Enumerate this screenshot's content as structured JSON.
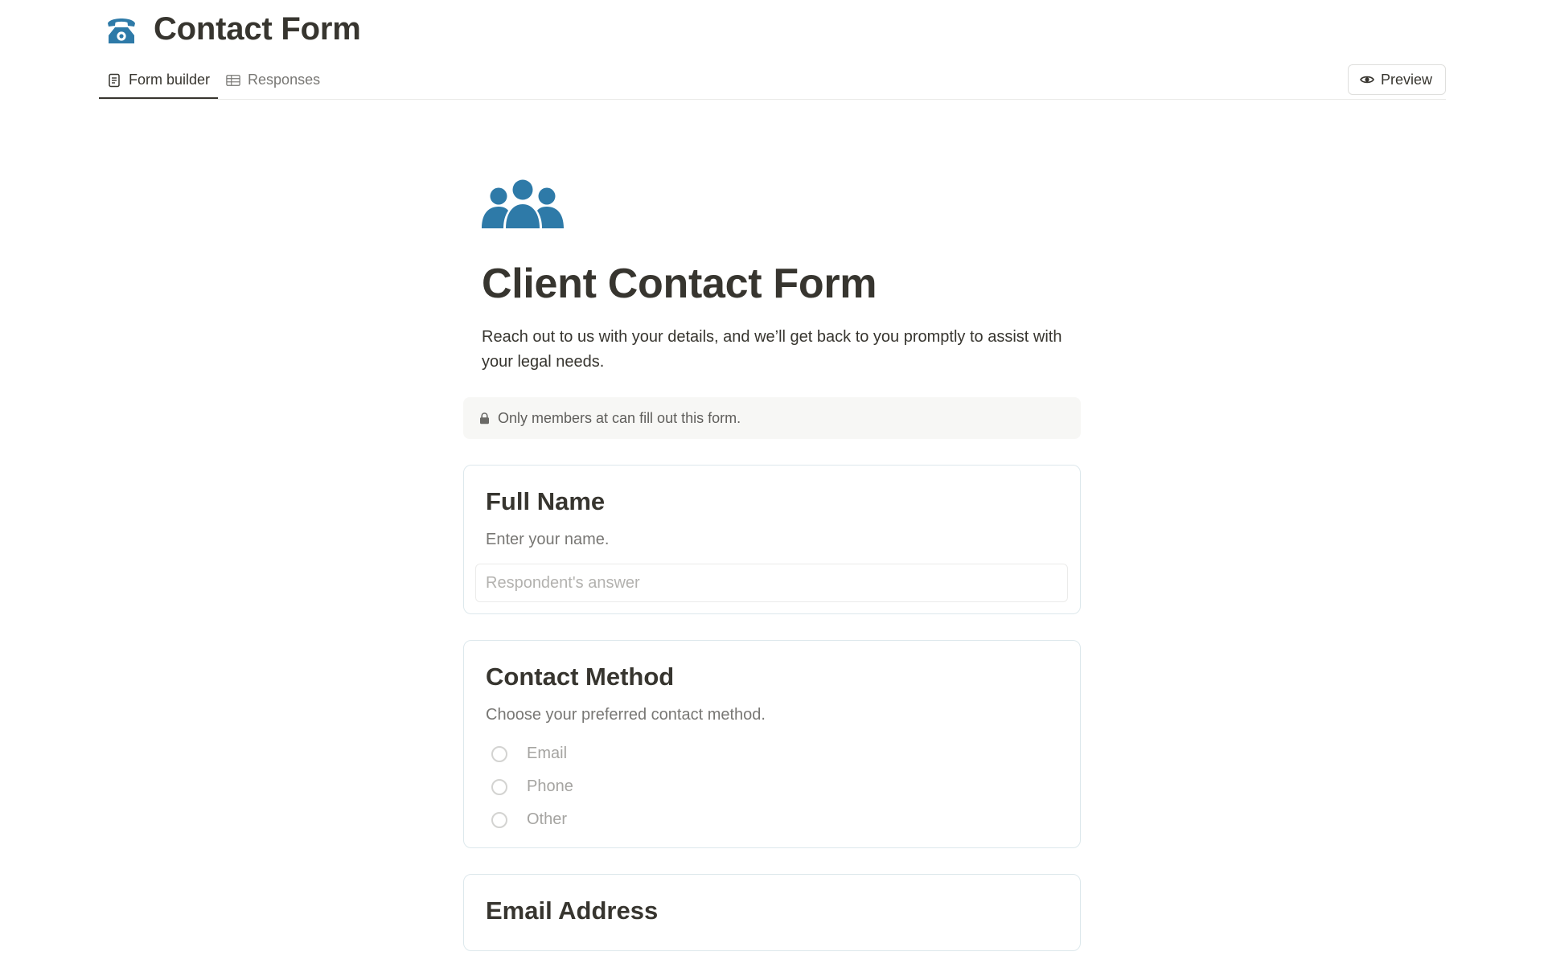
{
  "header": {
    "title": "Contact Form",
    "title_icon": "telephone-icon",
    "tabs": [
      {
        "label": "Form builder",
        "icon": "form-document-icon",
        "active": true
      },
      {
        "label": "Responses",
        "icon": "table-icon",
        "active": false
      }
    ],
    "preview_label": "Preview",
    "preview_icon": "eye-icon"
  },
  "form": {
    "icon": "people-group-icon",
    "title": "Client Contact Form",
    "description": "Reach out to us with your details, and we’ll get back to you promptly to assist with your legal needs.",
    "notice": "Only members at can fill out this form.",
    "notice_icon": "lock-icon",
    "questions": [
      {
        "title": "Full Name",
        "description": "Enter your name.",
        "type": "text",
        "placeholder": "Respondent's answer"
      },
      {
        "title": "Contact Method",
        "description": "Choose your preferred contact method.",
        "type": "radio",
        "options": [
          "Email",
          "Phone",
          "Other"
        ]
      },
      {
        "title": "Email Address",
        "type": "text"
      }
    ]
  },
  "colors": {
    "accent_blue": "#2e7aa8",
    "text": "#37352f",
    "muted": "#787774",
    "notice_bg": "#f7f7f5",
    "card_border": "#dde8ec"
  }
}
